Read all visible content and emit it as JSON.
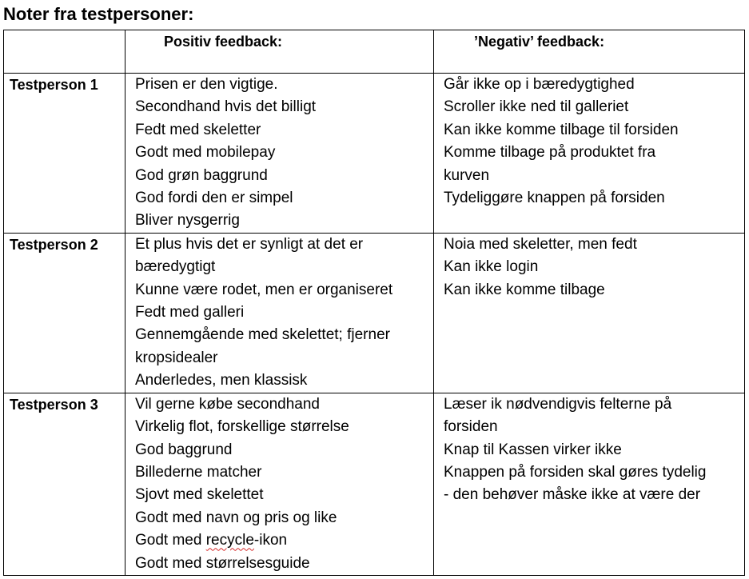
{
  "title": "Noter fra testpersoner:",
  "headers": {
    "positive": "Positiv feedback:",
    "negative": "’Negativ’ feedback:"
  },
  "rows": [
    {
      "label": "Testperson 1",
      "positive": [
        "Prisen er den vigtige.",
        "Secondhand hvis det billigt",
        "Fedt med skeletter",
        "Godt med mobilepay",
        "God grøn baggrund",
        "God fordi den er simpel",
        "Bliver nysgerrig"
      ],
      "negative": [
        "Går ikke op i bæredygtighed",
        "Scroller ikke ned til galleriet",
        "Kan ikke komme tilbage til forsiden",
        "Komme tilbage på produktet fra",
        "kurven",
        "Tydeliggøre knappen på forsiden"
      ]
    },
    {
      "label": "Testperson 2",
      "positive": [
        "Et plus hvis det er synligt at det er",
        "bæredygtigt",
        "Kunne være rodet, men er organiseret",
        "Fedt med galleri",
        "Gennemgående med skelettet; fjerner",
        "kropsidealer",
        "Anderledes, men klassisk"
      ],
      "negative": [
        "Noia med skeletter, men fedt",
        "Kan ikke login",
        "Kan ikke komme tilbage"
      ]
    },
    {
      "label": "Testperson 3",
      "positive": [
        "Vil gerne købe secondhand",
        "Virkelig flot, forskellige størrelse",
        "God baggrund",
        "Billederne matcher",
        "Sjovt med skelettet",
        "Godt med navn og pris og like",
        {
          "before": "Godt med ",
          "flagged": "recycle",
          "after": "-ikon"
        },
        "Godt med størrelsesguide"
      ],
      "negative": [
        "Læser ik nødvendigvis felterne på",
        "forsiden",
        "Knap til Kassen virker ikke",
        "Knappen på forsiden skal gøres tydelig",
        "- den behøver måske ikke at være der"
      ]
    }
  ],
  "colors": {
    "border": "#000000",
    "spellcheck_underline": "#d62a2a"
  }
}
